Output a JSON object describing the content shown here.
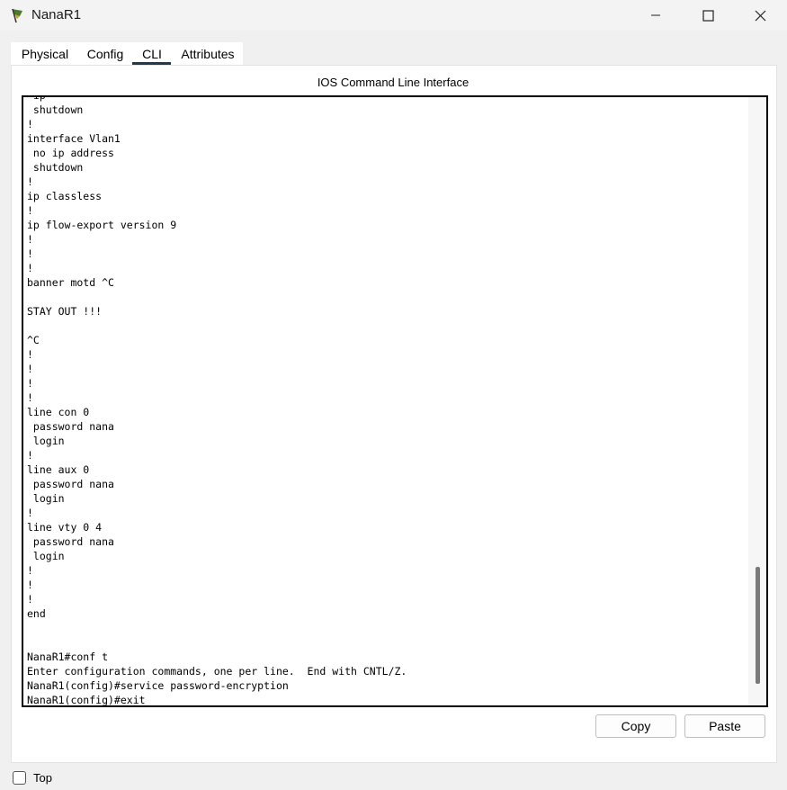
{
  "window": {
    "title": "NanaR1",
    "controls": {
      "minimize": "minimize-icon",
      "maximize": "maximize-icon",
      "close": "close-icon"
    }
  },
  "tabs": [
    {
      "label": "Physical"
    },
    {
      "label": "Config"
    },
    {
      "label": "CLI",
      "active": true
    },
    {
      "label": "Attributes"
    }
  ],
  "cli": {
    "title": "IOS Command Line Interface",
    "lines": [
      " ip",
      " shutdown",
      "!",
      "interface Vlan1",
      " no ip address",
      " shutdown",
      "!",
      "ip classless",
      "!",
      "ip flow-export version 9",
      "!",
      "!",
      "!",
      "banner motd ^C",
      "",
      "STAY OUT !!!",
      "",
      "^C",
      "!",
      "!",
      "!",
      "!",
      "line con 0",
      " password nana",
      " login",
      "!",
      "line aux 0",
      " password nana",
      " login",
      "!",
      "line vty 0 4",
      " password nana",
      " login",
      "!",
      "!",
      "!",
      "end",
      "",
      "",
      "NanaR1#conf t",
      "Enter configuration commands, one per line.  End with CNTL/Z.",
      "NanaR1(config)#service password-encryption",
      "NanaR1(config)#exit"
    ]
  },
  "buttons": {
    "copy": "Copy",
    "paste": "Paste"
  },
  "options": {
    "top_label": "Top",
    "top_checked": false
  }
}
